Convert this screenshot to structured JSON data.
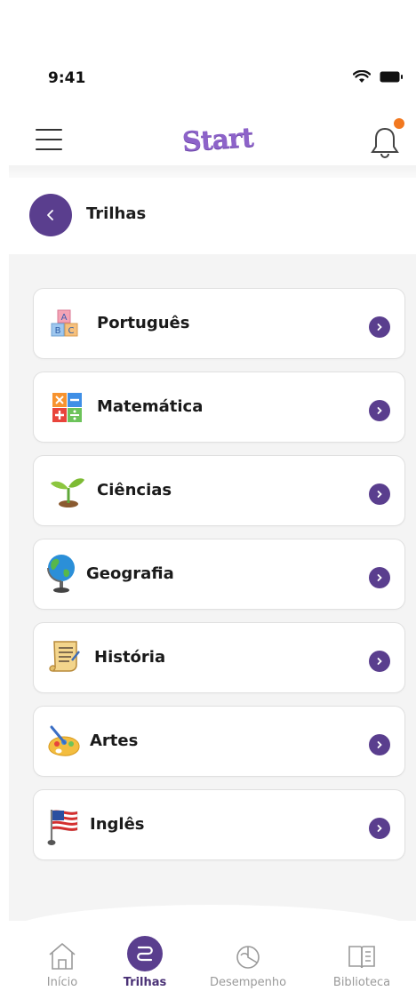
{
  "status_bar": {
    "time": "9:41"
  },
  "header": {
    "logo_text": "Start"
  },
  "page": {
    "title": "Trilhas"
  },
  "subjects": [
    {
      "label": "Português",
      "icon": "abc-blocks-icon"
    },
    {
      "label": "Matemática",
      "icon": "math-operations-icon"
    },
    {
      "label": "Ciências",
      "icon": "sprout-icon"
    },
    {
      "label": "Geografia",
      "icon": "globe-icon"
    },
    {
      "label": "História",
      "icon": "scroll-icon"
    },
    {
      "label": "Artes",
      "icon": "paint-palette-icon"
    },
    {
      "label": "Inglês",
      "icon": "us-flag-icon"
    }
  ],
  "bottom_nav": {
    "items": [
      {
        "label": "Início",
        "icon": "home-icon"
      },
      {
        "label": "Trilhas",
        "icon": "trails-icon",
        "active": true
      },
      {
        "label": "Desempenho",
        "icon": "performance-icon"
      },
      {
        "label": "Biblioteca",
        "icon": "book-icon"
      }
    ]
  },
  "colors": {
    "primary": "#5a3e8e",
    "accent": "#f2781f",
    "logo": "#8d63c9",
    "background": "#f4f4f4"
  }
}
